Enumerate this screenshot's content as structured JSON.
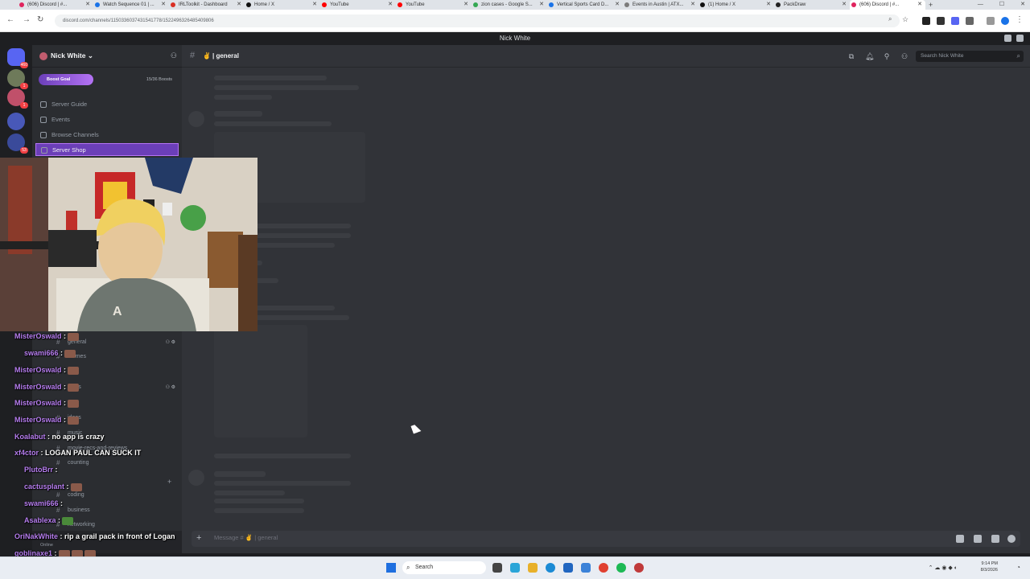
{
  "browser": {
    "tabs": [
      {
        "title": "(606) Discord | #..."
      },
      {
        "title": "Watch Sequence 01 | ..."
      },
      {
        "title": "IRLToolkit - Dashboard"
      },
      {
        "title": "Home / X"
      },
      {
        "title": "YouTube"
      },
      {
        "title": "YouTube"
      },
      {
        "title": "zion cases - Google S..."
      },
      {
        "title": "Vertical Sports Card D..."
      },
      {
        "title": "Events in Austin | ATX..."
      },
      {
        "title": "(1) Home / X"
      },
      {
        "title": "PackDraw"
      },
      {
        "title": "(606) Discord | #..."
      }
    ],
    "new_tab": "+",
    "url": "discord.com/channels/1150336037431541778/1522496326485409806"
  },
  "app": {
    "title": "Nick White"
  },
  "rail": {
    "badges": [
      "460",
      "1",
      "1",
      "53"
    ]
  },
  "sidebar": {
    "server_name": "Nick White",
    "boost_label": "Boost Goal",
    "boost_count": "15/36 Boosts",
    "boost_progress": 0.4,
    "nav": [
      {
        "label": "Server Guide"
      },
      {
        "label": "Events"
      },
      {
        "label": "Browse Channels"
      },
      {
        "label": "Server Shop"
      }
    ],
    "channels": [
      {
        "label": "general"
      },
      {
        "label": "memes"
      },
      {
        "label": "cats"
      },
      {
        "label": "ideas"
      },
      {
        "label": "ideas"
      },
      {
        "label": "music"
      },
      {
        "label": "movie-recs-and-reviews"
      },
      {
        "label": "counting"
      },
      {
        "label": "coding"
      },
      {
        "label": "business"
      },
      {
        "label": "networking"
      }
    ],
    "user_status": "Online"
  },
  "chat_overlay": [
    {
      "user": "MisterOswald",
      "text": ":"
    },
    {
      "user": "swami666",
      "text": ":"
    },
    {
      "user": "MisterOswald",
      "text": ":"
    },
    {
      "user": "MisterOswald",
      "text": ":"
    },
    {
      "user": "MisterOswald",
      "text": ":"
    },
    {
      "user": "MisterOswald",
      "text": ":"
    },
    {
      "user": "Koalabut",
      "text": ": no app is crazy"
    },
    {
      "user": "xf4ctor",
      "text": ": LOGAN PAUL CAN SUCK IT"
    },
    {
      "user": "PlutoBrr",
      "text": ":"
    },
    {
      "user": "cactusplant",
      "text": ":"
    },
    {
      "user": "swami666",
      "text": ":"
    },
    {
      "user": "Asablexa",
      "text": ":"
    },
    {
      "user": "OriNakWhite",
      "text": ": rip a grail pack in front of Logan"
    },
    {
      "user": "goblinaxe1",
      "text": ":"
    },
    {
      "user": "swami666",
      "text": ":"
    }
  ],
  "main": {
    "channel_name": "general",
    "search_placeholder": "Search Nick White",
    "composer_placeholder": "Message # ✌ | general"
  },
  "taskbar": {
    "search_label": "Search",
    "time": "9:14 PM",
    "date": "8/3/2026"
  }
}
